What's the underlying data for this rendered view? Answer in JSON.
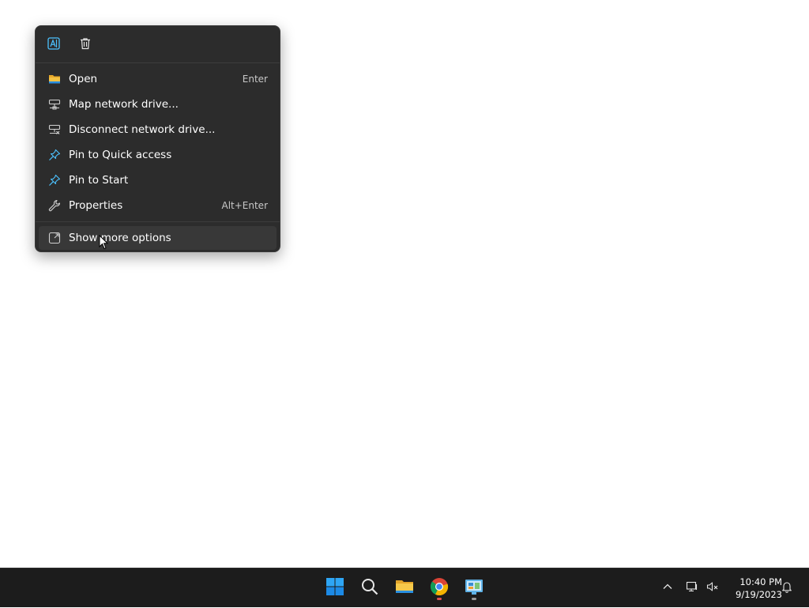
{
  "context_menu": {
    "top_actions": [
      {
        "icon": "rename-icon"
      },
      {
        "icon": "delete-icon"
      }
    ],
    "items": [
      {
        "label": "Open",
        "shortcut": "Enter",
        "icon": "folder-icon"
      },
      {
        "label": "Map network drive...",
        "shortcut": "",
        "icon": "network-drive-icon"
      },
      {
        "label": "Disconnect network drive...",
        "shortcut": "",
        "icon": "disconnect-network-drive-icon"
      },
      {
        "label": "Pin to Quick access",
        "shortcut": "",
        "icon": "pin-icon"
      },
      {
        "label": "Pin to Start",
        "shortcut": "",
        "icon": "pin-icon"
      },
      {
        "label": "Properties",
        "shortcut": "Alt+Enter",
        "icon": "wrench-icon"
      }
    ],
    "more_options": {
      "label": "Show more options",
      "icon": "show-more-options-icon"
    }
  },
  "taskbar": {
    "apps": [
      {
        "name": "start",
        "icon": "windows-start-icon"
      },
      {
        "name": "search",
        "icon": "search-icon"
      },
      {
        "name": "file-explorer",
        "icon": "file-explorer-icon"
      },
      {
        "name": "chrome",
        "icon": "chrome-icon"
      },
      {
        "name": "control-panel",
        "icon": "control-panel-icon"
      }
    ],
    "tray": {
      "icons": [
        "chevron-up-icon",
        "network-icon",
        "volume-muted-icon",
        "notification-bell-icon"
      ],
      "time": "10:40 PM",
      "date": "9/19/2023"
    }
  },
  "colors": {
    "menu_bg": "#2c2c2c",
    "menu_hover": "#383838",
    "taskbar_bg": "#1c1c1c",
    "accent_blue": "#4cc2ff",
    "folder_yellow": "#f3c243"
  }
}
